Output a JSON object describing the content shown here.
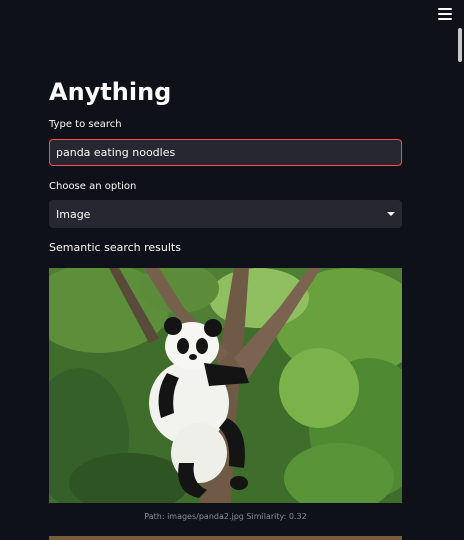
{
  "page": {
    "title": "Anything"
  },
  "search": {
    "label": "Type to search",
    "value": "panda eating noodles"
  },
  "select": {
    "label": "Choose an option",
    "value": "Image"
  },
  "results": {
    "heading": "Semantic search results",
    "items": [
      {
        "image_subject": "panda-in-tree",
        "caption": "Path: images/panda2.jpg Similarity: 0.32"
      }
    ]
  },
  "icons": {
    "menu": "hamburger-menu-icon",
    "dropdown": "chevron-down-icon"
  },
  "colors": {
    "background": "#0e1117",
    "input_background": "#262730",
    "focus_border": "#ff4b4b",
    "text": "#fafafa",
    "caption_text": "#8b8d97"
  }
}
